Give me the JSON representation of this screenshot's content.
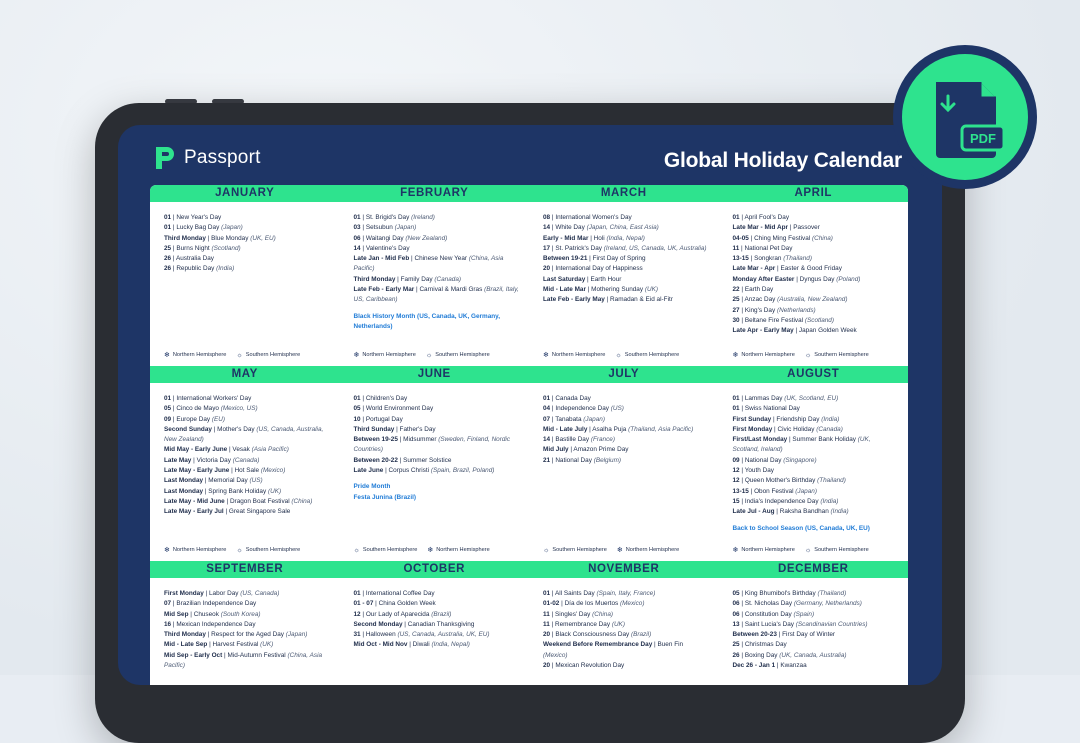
{
  "brand": {
    "name": "Passport"
  },
  "title": "Global Holiday Calendar",
  "pdf_badge": {
    "label": "PDF",
    "icon": "pdf-download-icon"
  },
  "legend": {
    "north": "Northern Hemisphere",
    "south": "Southern Hemisphere"
  },
  "colors": {
    "navy": "#1e3566",
    "green": "#2ee38e",
    "link": "#1f7bd6"
  },
  "months": [
    {
      "name": "JANUARY",
      "legend_order": [
        "north",
        "south"
      ],
      "entries": [
        [
          "01",
          " | New Year's Day",
          ""
        ],
        [
          "01",
          " | Lucky Bag Day ",
          "(Japan)"
        ],
        [
          "Third Monday",
          " | Blue Monday ",
          "(UK, EU)"
        ],
        [
          "25",
          " | Burns Night ",
          "(Scotland)"
        ],
        [
          "26",
          " | Australia Day",
          ""
        ],
        [
          "26",
          " | Republic Day ",
          "(India)"
        ]
      ],
      "link": ""
    },
    {
      "name": "FEBRUARY",
      "legend_order": [
        "north",
        "south"
      ],
      "entries": [
        [
          "01",
          " | St. Brigid's Day ",
          "(Ireland)"
        ],
        [
          "03",
          " | Setsubun ",
          "(Japan)"
        ],
        [
          "06",
          " | Waitangi Day ",
          "(New Zealand)"
        ],
        [
          "14",
          " | Valentine's Day",
          ""
        ],
        [
          "Late Jan - Mid Feb",
          " | Chinese New Year ",
          "(China, Asia Pacific)"
        ],
        [
          "Third Monday",
          " | Family Day ",
          "(Canada)"
        ],
        [
          "Late Feb - Early Mar",
          " | Carnival & Mardi Gras ",
          "(Brazil, Italy, US, Caribbean)"
        ]
      ],
      "link": "Black History Month (US, Canada, UK, Germany, Netherlands)"
    },
    {
      "name": "MARCH",
      "legend_order": [
        "north",
        "south"
      ],
      "entries": [
        [
          "08",
          " | International Women's Day",
          ""
        ],
        [
          "14",
          " | White Day ",
          "(Japan, China, East Asia)"
        ],
        [
          "Early - Mid Mar",
          " | Holi ",
          "(India, Nepal)"
        ],
        [
          "17",
          " | St. Patrick's Day ",
          "(Ireland, US, Canada, UK, Australia)"
        ],
        [
          "Between 19-21",
          " | First Day of Spring",
          ""
        ],
        [
          "20",
          " | International Day of Happiness",
          ""
        ],
        [
          "Last Saturday",
          " | Earth Hour",
          ""
        ],
        [
          "Mid - Late Mar",
          " | Mothering Sunday ",
          "(UK)"
        ],
        [
          "Late Feb - Early May",
          " | Ramadan & Eid al-Fitr",
          ""
        ]
      ],
      "link": ""
    },
    {
      "name": "APRIL",
      "legend_order": [
        "north",
        "south"
      ],
      "entries": [
        [
          "01",
          " | April Fool's Day",
          ""
        ],
        [
          "Late Mar - Mid Apr",
          " | Passover",
          ""
        ],
        [
          "04-05",
          " | Ching Ming Festival ",
          "(China)"
        ],
        [
          "11",
          " | National Pet Day",
          ""
        ],
        [
          "13-15",
          " | Songkran ",
          "(Thailand)"
        ],
        [
          "Late Mar - Apr",
          " | Easter & Good Friday",
          ""
        ],
        [
          "Monday After Easter",
          " | Dyngus Day ",
          "(Poland)"
        ],
        [
          "22",
          " | Earth Day",
          ""
        ],
        [
          "25",
          " | Anzac Day ",
          "(Australia, New Zealand)"
        ],
        [
          "27",
          " | King's Day ",
          "(Netherlands)"
        ],
        [
          "30",
          " | Beltane Fire Festival ",
          "(Scotland)"
        ],
        [
          "Late Apr - Early May",
          " | Japan Golden Week",
          ""
        ]
      ],
      "link": ""
    },
    {
      "name": "MAY",
      "legend_order": [
        "north",
        "south"
      ],
      "entries": [
        [
          "01",
          " | International Workers' Day",
          ""
        ],
        [
          "05",
          " | Cinco de Mayo ",
          "(Mexico, US)"
        ],
        [
          "09",
          " | Europe Day ",
          "(EU)"
        ],
        [
          "Second Sunday",
          " | Mother's Day ",
          "(US, Canada, Australia, New Zealand)"
        ],
        [
          "Mid May - Early June",
          " | Vesak ",
          "(Asia Pacific)"
        ],
        [
          "Late May",
          " | Victoria Day ",
          "(Canada)"
        ],
        [
          "Late May - Early June",
          " | Hot Sale ",
          "(Mexico)"
        ],
        [
          "Last Monday",
          " | Memorial Day ",
          "(US)"
        ],
        [
          "Last Monday",
          " | Spring Bank Holiday ",
          "(UK)"
        ],
        [
          "Late May - Mid June",
          " | Dragon Boat Festival ",
          "(China)"
        ],
        [
          "Late May - Early Jul",
          " | Great Singapore Sale",
          ""
        ]
      ],
      "link": ""
    },
    {
      "name": "JUNE",
      "legend_order": [
        "south",
        "north"
      ],
      "entries": [
        [
          "01",
          " | Children's Day",
          ""
        ],
        [
          "05",
          " | World Environment Day",
          ""
        ],
        [
          "10",
          " | Portugal Day",
          ""
        ],
        [
          "Third Sunday",
          " | Father's Day",
          ""
        ],
        [
          "Between 19-25",
          " | Midsummer ",
          "(Sweden, Finland, Nordic Countries)"
        ],
        [
          "Between 20-22",
          " | Summer Solstice",
          ""
        ],
        [
          "Late June",
          " | Corpus Christi ",
          "(Spain, Brazil, Poland)"
        ]
      ],
      "link": "Pride Month|Festa Junina (Brazil)"
    },
    {
      "name": "JULY",
      "legend_order": [
        "south",
        "north"
      ],
      "entries": [
        [
          "01",
          " | Canada Day",
          ""
        ],
        [
          "04",
          " | Independence Day ",
          "(US)"
        ],
        [
          "07",
          " | Tanabata ",
          "(Japan)"
        ],
        [
          "Mid - Late July",
          " | Asalha Puja ",
          "(Thailand, Asia Pacific)"
        ],
        [
          "14",
          " | Bastille Day ",
          "(France)"
        ],
        [
          "Mid July",
          " | Amazon Prime Day",
          ""
        ],
        [
          "21",
          " | National Day ",
          "(Belgium)"
        ]
      ],
      "link": ""
    },
    {
      "name": "AUGUST",
      "legend_order": [
        "north",
        "south"
      ],
      "entries": [
        [
          "01",
          " | Lammas Day ",
          "(UK, Scotland, EU)"
        ],
        [
          "01",
          " | Swiss National Day",
          ""
        ],
        [
          "First Sunday",
          " | Friendship Day ",
          "(India)"
        ],
        [
          "First Monday",
          " | Civic Holiday ",
          "(Canada)"
        ],
        [
          "First/Last Monday",
          " | Summer Bank Holiday ",
          "(UK, Scotland, Ireland)"
        ],
        [
          "09",
          " | National Day ",
          "(Singapore)"
        ],
        [
          "12",
          " | Youth Day",
          ""
        ],
        [
          "12",
          " | Queen Mother's Birthday ",
          "(Thailand)"
        ],
        [
          "13-15",
          " | Obon Festival ",
          "(Japan)"
        ],
        [
          "15",
          " | India's Independence Day ",
          "(India)"
        ],
        [
          "Late Jul - Aug",
          " | Raksha Bandhan ",
          "(India)"
        ]
      ],
      "link": "Back to School Season (US, Canada, UK, EU)"
    },
    {
      "name": "SEPTEMBER",
      "legend_order": [
        "north",
        "south"
      ],
      "entries": [
        [
          "First Monday",
          " | Labor Day ",
          "(US, Canada)"
        ],
        [
          "07",
          " | Brazilian Independence Day",
          ""
        ],
        [
          "Mid Sep",
          " | Chuseok ",
          "(South Korea)"
        ],
        [
          "16",
          " | Mexican Independence Day",
          ""
        ],
        [
          "Third Monday",
          " | Respect for the Aged Day ",
          "(Japan)"
        ],
        [
          "Mid - Late Sep",
          " | Harvest Festival ",
          "(UK)"
        ],
        [
          "Mid Sep - Early Oct",
          " | Mid-Autumn Festival ",
          "(China, Asia Pacific)"
        ]
      ],
      "link": ""
    },
    {
      "name": "OCTOBER",
      "legend_order": [
        "north",
        "south"
      ],
      "entries": [
        [
          "01",
          " | International Coffee Day",
          ""
        ],
        [
          "01 - 07",
          " | China Golden Week",
          ""
        ],
        [
          "12",
          " | Our Lady of Aparecida ",
          "(Brazil)"
        ],
        [
          "Second Monday",
          " | Canadian Thanksgiving",
          ""
        ],
        [
          "31",
          " | Halloween ",
          "(US, Canada, Australia, UK, EU)"
        ],
        [
          "Mid Oct - Mid Nov",
          " | Diwali ",
          "(India, Nepal)"
        ]
      ],
      "link": ""
    },
    {
      "name": "NOVEMBER",
      "legend_order": [
        "north",
        "south"
      ],
      "entries": [
        [
          "01",
          " | All Saints Day ",
          "(Spain, Italy, France)"
        ],
        [
          "01-02",
          " | Día de los Muertos ",
          "(Mexico)"
        ],
        [
          "11",
          " | Singles' Day ",
          "(China)"
        ],
        [
          "11",
          " | Remembrance Day ",
          "(UK)"
        ],
        [
          "20",
          " | Black Consciousness Day ",
          "(Brazil)"
        ],
        [
          "Weekend Before Remembrance Day",
          " | Buen Fin ",
          "(Mexico)"
        ],
        [
          "20",
          " | Mexican Revolution Day",
          ""
        ]
      ],
      "link": ""
    },
    {
      "name": "DECEMBER",
      "legend_order": [
        "north",
        "south"
      ],
      "entries": [
        [
          "05",
          " | King Bhumibol's Birthday ",
          "(Thailand)"
        ],
        [
          "06",
          " | St. Nicholas Day ",
          "(Germany, Netherlands)"
        ],
        [
          "06",
          " | Constitution Day ",
          "(Spain)"
        ],
        [
          "13",
          " | Saint Lucia's Day ",
          "(Scandinavian Countries)"
        ],
        [
          "Between 20-23",
          " | First Day of Winter",
          ""
        ],
        [
          "25",
          " | Christmas Day",
          ""
        ],
        [
          "26",
          " | Boxing Day ",
          "(UK, Canada, Australia)"
        ],
        [
          "Dec 26 - Jan 1",
          " | Kwanzaa",
          ""
        ]
      ],
      "link": ""
    }
  ]
}
